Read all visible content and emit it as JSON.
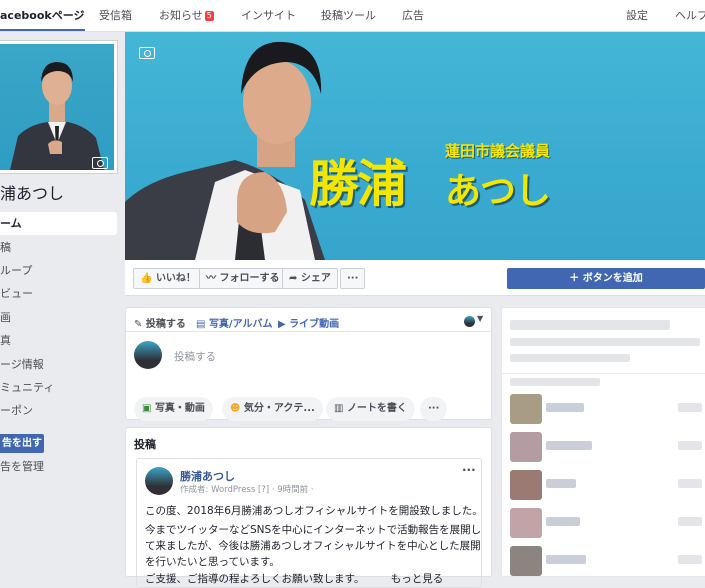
{
  "topnav": {
    "items": [
      {
        "label": "acebookページ",
        "active": true
      },
      {
        "label": "受信箱"
      },
      {
        "label": "お知らせ",
        "badge": "5"
      },
      {
        "label": "インサイト"
      },
      {
        "label": "投稿ツール"
      },
      {
        "label": "広告"
      },
      {
        "label": "設定"
      },
      {
        "label": "ヘルプ"
      }
    ]
  },
  "sidebar": {
    "page_name": "浦あつし",
    "items": [
      {
        "label": "ーム",
        "active": true
      },
      {
        "label": "稿"
      },
      {
        "label": "ループ"
      },
      {
        "label": "ビュー"
      },
      {
        "label": "画"
      },
      {
        "label": "真"
      },
      {
        "label": "ージ情報"
      },
      {
        "label": "ミュニティ"
      },
      {
        "label": "ーポン"
      }
    ],
    "ad_button": "告を出す",
    "manage_ads": "告を管理"
  },
  "cover": {
    "name": "勝浦",
    "name_kana": "あつし",
    "position": "蓮田市議会議員",
    "accent_color": "#f3e600"
  },
  "actions": {
    "like": "いいね！",
    "follow": "フォローする",
    "share": "シェア",
    "more": "···",
    "add_button": "＋ ボタンを追加"
  },
  "composer": {
    "tabs": [
      "投稿する",
      "写真/アルバム",
      "ライブ動画"
    ],
    "placeholder": "投稿する",
    "options": [
      "写真・動画",
      "気分・アクテ...",
      "ノートを書く"
    ],
    "more": "···"
  },
  "posts": {
    "heading": "投稿",
    "author": "勝浦あつし",
    "meta": "作成者: WordPress [?] · 9時間前 ·",
    "more": "···",
    "lines": [
      "この度、2018年6月勝浦あつしオフィシャルサイトを開設致しました。",
      "今までツイッターなどSNSを中心にインターネットで活動報告を展開し",
      "て来ましたが、今後は勝浦あつしオフィシャルサイトを中心とした展開",
      "を行いたいと思っています。",
      "ご支援、ご指導の程よろしくお願い致します。　　　もっと見る"
    ]
  }
}
